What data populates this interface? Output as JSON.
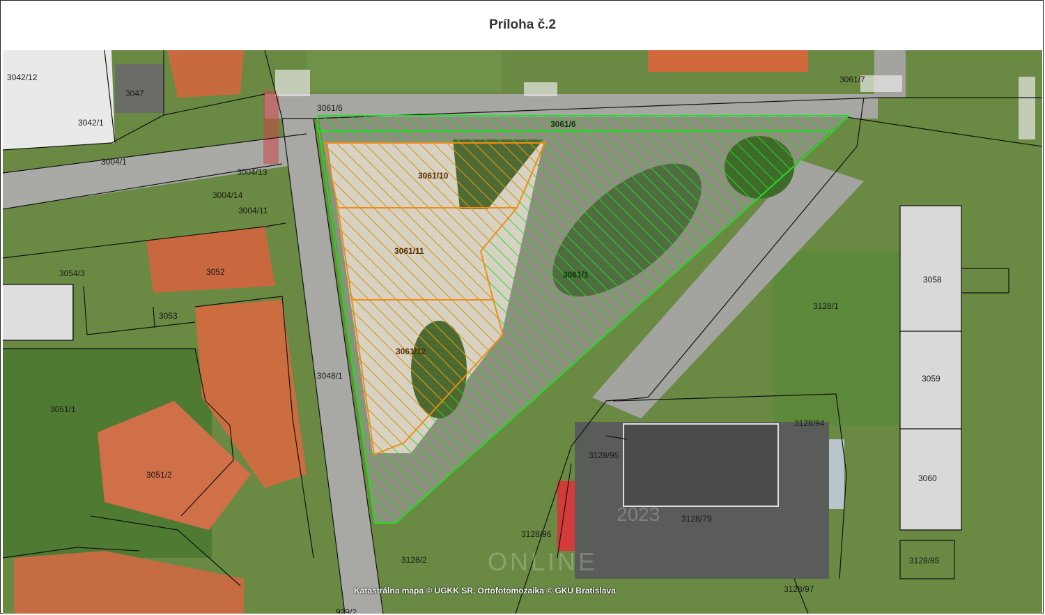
{
  "title": "Príloha č.2",
  "attribution": "Katastrálna mapa © ÚGKK SR, Ortofotomozaika © GKÚ Bratislava",
  "watermark": "ONLINE",
  "watermark_year": "2023",
  "colors": {
    "green_outline": "#22dd22",
    "orange_outline": "#f08c14",
    "cadastre_lines": "#111111"
  },
  "highlighted_plots": [
    {
      "id": "3061/6",
      "color": "green"
    },
    {
      "id": "3061/1",
      "color": "green"
    },
    {
      "id": "3061/10",
      "color": "orange"
    },
    {
      "id": "3061/11",
      "color": "orange"
    },
    {
      "id": "3061/12",
      "color": "orange"
    }
  ],
  "parcels": {
    "p3042_12": "3042/12",
    "p3047": "3047",
    "p3042_1": "3042/1",
    "p3061_6_top": "3061/6",
    "p3061_7": "3061/7",
    "p3004_1": "3004/1",
    "p3004_13": "3004/13",
    "p3004_14": "3004/14",
    "p3004_11": "3004/11",
    "p3054_3": "3054/3",
    "p3052": "3052",
    "p3053": "3053",
    "p3048_1": "3048/1",
    "p3051_1": "3051/1",
    "p3051_2": "3051/2",
    "p3128_1": "3128/1",
    "p3058": "3058",
    "p3059": "3059",
    "p3060": "3060",
    "p3128_94": "3128/94",
    "p3128_95": "3128/95",
    "p3128_79": "3128/79",
    "p3128_96": "3128/96",
    "p3128_2": "3128/2",
    "p3128_85": "3128/85",
    "p3128_97": "3128/97",
    "p929_2": "929/2"
  }
}
